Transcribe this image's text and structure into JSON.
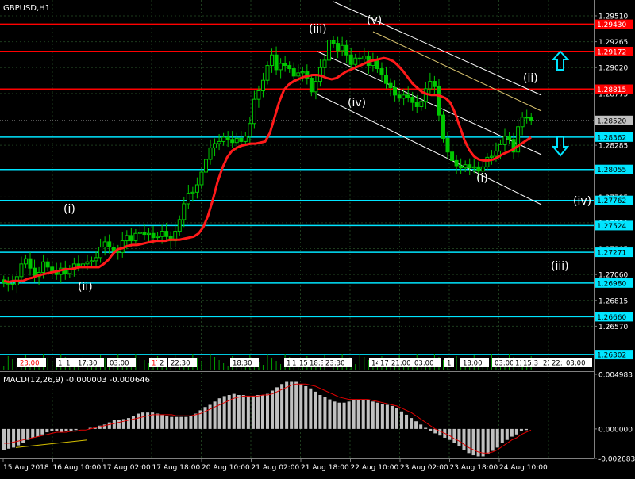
{
  "chart_data": [
    {
      "type": "candlestick",
      "title": "GBPUSD,H1",
      "ylim": [
        1.2616,
        1.296
      ],
      "price_axis_ticks": [
        "1.29510",
        "1.29265",
        "1.29020",
        "1.28775",
        "1.28285",
        "1.27795",
        "1.27550",
        "1.27305",
        "1.27060",
        "1.26815",
        "1.26570"
      ],
      "price_tags": [
        {
          "label": "1.29430",
          "kind": "resistance",
          "color": "#ff0000",
          "value": 1.2943
        },
        {
          "label": "1.29172",
          "kind": "resistance",
          "color": "#ff0000",
          "value": 1.29172
        },
        {
          "label": "1.28815",
          "kind": "resistance",
          "color": "#ff0000",
          "value": 1.28815
        },
        {
          "label": "1.28520",
          "kind": "current",
          "color": "#c0c0c0",
          "value": 1.2852
        },
        {
          "label": "1.28362",
          "kind": "support",
          "color": "#00e5ff",
          "value": 1.28362
        },
        {
          "label": "1.28055",
          "kind": "support",
          "color": "#00e5ff",
          "value": 1.28055
        },
        {
          "label": "1.27762",
          "kind": "support",
          "color": "#00e5ff",
          "value": 1.27762
        },
        {
          "label": "1.27524",
          "kind": "support",
          "color": "#00e5ff",
          "value": 1.27524
        },
        {
          "label": "1.27271",
          "kind": "support",
          "color": "#00e5ff",
          "value": 1.27271
        },
        {
          "label": "1.26980",
          "kind": "support",
          "color": "#00e5ff",
          "value": 1.2698
        },
        {
          "label": "1.26660",
          "kind": "support",
          "color": "#00e5ff",
          "value": 1.2666
        },
        {
          "label": "1.26302",
          "kind": "support",
          "color": "#00e5ff",
          "value": 1.26302
        }
      ],
      "wave_labels": [
        "(i)",
        "(ii)",
        "(iii)",
        "(iv)",
        "(v)",
        "(i)",
        "(ii)",
        "(iii)",
        "(iv)"
      ],
      "time_markers": [
        "23:00",
        "11:",
        "1",
        "17:30",
        "03:00",
        "17",
        "2",
        "22:30",
        "18:30",
        "1",
        "1",
        "15",
        "18:3",
        "23:30",
        "14",
        "17:",
        "21:00",
        "03:00",
        "1",
        "18:00",
        "03:00",
        "11:",
        "15:3",
        "20",
        "22:",
        "03:00"
      ],
      "close_series": [
        1.2698,
        1.2697,
        1.2696,
        1.2704,
        1.2716,
        1.2721,
        1.2712,
        1.2704,
        1.2708,
        1.2718,
        1.2713,
        1.2709,
        1.2706,
        1.2712,
        1.2707,
        1.2711,
        1.2716,
        1.2714,
        1.2716,
        1.2718,
        1.2719,
        1.2722,
        1.2732,
        1.2737,
        1.2732,
        1.2728,
        1.2727,
        1.2738,
        1.2743,
        1.2738,
        1.2745,
        1.2746,
        1.2744,
        1.2745,
        1.2741,
        1.2742,
        1.2747,
        1.2742,
        1.2738,
        1.2747,
        1.2758,
        1.2773,
        1.2783,
        1.2784,
        1.2791,
        1.2803,
        1.2815,
        1.2826,
        1.283,
        1.2832,
        1.2836,
        1.2834,
        1.2831,
        1.2835,
        1.2832,
        1.2837,
        1.2849,
        1.2872,
        1.288,
        1.289,
        1.2904,
        1.2914,
        1.29,
        1.2906,
        1.2904,
        1.2901,
        1.2894,
        1.2897,
        1.2898,
        1.2892,
        1.2879,
        1.2889,
        1.2902,
        1.2909,
        1.2928,
        1.2925,
        1.2918,
        1.2923,
        1.2914,
        1.2905,
        1.2911,
        1.291,
        1.2913,
        1.2904,
        1.2909,
        1.2901,
        1.2895,
        1.2887,
        1.2883,
        1.2876,
        1.2873,
        1.2876,
        1.2874,
        1.2869,
        1.2865,
        1.287,
        1.2882,
        1.2889,
        1.2884,
        1.2857,
        1.2835,
        1.2822,
        1.2814,
        1.2809,
        1.2807,
        1.281,
        1.2807,
        1.2808,
        1.2804,
        1.2808,
        1.2817,
        1.2818,
        1.2823,
        1.2829,
        1.2837,
        1.2834,
        1.2822,
        1.2846,
        1.2855,
        1.2855,
        1.2852
      ],
      "ma_series": [
        1.27,
        1.2699,
        1.27,
        1.27,
        1.27,
        1.2702,
        1.2703,
        1.2705,
        1.2706,
        1.2707,
        1.2708,
        1.2709,
        1.271,
        1.2711,
        1.2711,
        1.2712,
        1.2713,
        1.2713,
        1.2713,
        1.2713,
        1.2713,
        1.2716,
        1.272,
        1.2726,
        1.273,
        1.2731,
        1.2733,
        1.2734,
        1.2734,
        1.2735,
        1.2736,
        1.2737,
        1.2738,
        1.2738,
        1.2738,
        1.2739,
        1.2739,
        1.2739,
        1.274,
        1.2741,
        1.2742,
        1.2745,
        1.2751,
        1.2762,
        1.2777,
        1.2794,
        1.2807,
        1.2817,
        1.2823,
        1.2826,
        1.2828,
        1.2829,
        1.283,
        1.283,
        1.2831,
        1.2832,
        1.284,
        1.2855,
        1.287,
        1.2881,
        1.2886,
        1.2889,
        1.2891,
        1.2893,
        1.2894,
        1.2895,
        1.2895,
        1.2894,
        1.2892,
        1.2891,
        1.2892,
        1.2895,
        1.2898,
        1.29,
        1.2902,
        1.2904,
        1.2906,
        1.2908,
        1.2909,
        1.291,
        1.2911,
        1.291,
        1.2908,
        1.2904,
        1.2899,
        1.2893,
        1.2887,
        1.2883,
        1.2879,
        1.2877,
        1.2876,
        1.2876,
        1.2875,
        1.2873,
        1.2869,
        1.2859,
        1.2846,
        1.2833,
        1.2824,
        1.2818,
        1.2815,
        1.2814,
        1.2814,
        1.2815,
        1.2817,
        1.282,
        1.2822,
        1.2824,
        1.2827,
        1.283,
        1.2833,
        1.2836
      ],
      "annotations": [
        "up-arrow at 1.29172 (cyan outline)",
        "down-arrow near 1.28362 (cyan outline)",
        "descending channel (white lines)"
      ]
    },
    {
      "type": "bar",
      "title": "MACD(12,26,9) -0.000003 -0.000646",
      "ylim": [
        -0.002683,
        0.004983
      ],
      "axis_ticks": [
        "0.004983",
        "0.000000",
        "-0.002683"
      ],
      "histogram": [
        -0.0019,
        -0.0018,
        -0.0017,
        -0.0015,
        -0.0013,
        -0.001,
        -0.0008,
        -0.0007,
        -0.0005,
        -0.0003,
        -0.0002,
        -0.0002,
        -0.0003,
        -0.0002,
        -0.0002,
        -0.0001,
        0.0,
        0.0,
        0.0001,
        0.0002,
        0.0003,
        0.0004,
        0.0006,
        0.0008,
        0.0008,
        0.0009,
        0.001,
        0.0012,
        0.0014,
        0.0015,
        0.0015,
        0.0015,
        0.0014,
        0.0013,
        0.0012,
        0.0011,
        0.0011,
        0.0011,
        0.0011,
        0.0012,
        0.0014,
        0.0017,
        0.002,
        0.0022,
        0.0025,
        0.0028,
        0.003,
        0.0031,
        0.0032,
        0.0031,
        0.0031,
        0.003,
        0.003,
        0.0031,
        0.0031,
        0.0032,
        0.0035,
        0.0038,
        0.0041,
        0.0043,
        0.0043,
        0.0043,
        0.0041,
        0.0039,
        0.0037,
        0.0034,
        0.0031,
        0.0029,
        0.0027,
        0.0025,
        0.0024,
        0.0024,
        0.0025,
        0.0026,
        0.0027,
        0.0027,
        0.0026,
        0.0025,
        0.0024,
        0.0023,
        0.0022,
        0.0021,
        0.0019,
        0.0016,
        0.0013,
        0.001,
        0.0007,
        0.0004,
        0.0001,
        -0.0002,
        -0.0004,
        -0.0006,
        -0.0008,
        -0.001,
        -0.0013,
        -0.0016,
        -0.0019,
        -0.0022,
        -0.0024,
        -0.0025,
        -0.0025,
        -0.0023,
        -0.002,
        -0.0017,
        -0.0013,
        -0.001,
        -0.0007,
        -0.0005,
        -0.0002,
        -0.0001,
        0.0
      ],
      "signal": [
        -0.0013,
        -0.0013,
        -0.0012,
        -0.0011,
        -0.001,
        -0.0009,
        -0.0008,
        -0.0007,
        -0.0006,
        -0.0005,
        -0.0004,
        -0.0003,
        -0.0003,
        -0.0003,
        -0.0002,
        -0.0002,
        -0.0001,
        -0.0001,
        0.0,
        0.0001,
        0.0002,
        0.0003,
        0.0004,
        0.0005,
        0.0006,
        0.0007,
        0.0008,
        0.0009,
        0.001,
        0.0011,
        0.0012,
        0.0013,
        0.0013,
        0.0013,
        0.0013,
        0.0013,
        0.0012,
        0.0012,
        0.0012,
        0.0012,
        0.0013,
        0.0014,
        0.0016,
        0.0018,
        0.002,
        0.0022,
        0.0024,
        0.0026,
        0.0028,
        0.0029,
        0.003,
        0.003,
        0.003,
        0.003,
        0.0031,
        0.0031,
        0.0032,
        0.0034,
        0.0036,
        0.0038,
        0.004,
        0.0041,
        0.0041,
        0.0041,
        0.004,
        0.0039,
        0.0037,
        0.0035,
        0.0033,
        0.0031,
        0.0029,
        0.0028,
        0.0027,
        0.0027,
        0.0027,
        0.0027,
        0.0027,
        0.0026,
        0.0025,
        0.0024,
        0.0023,
        0.0022,
        0.0021,
        0.0019,
        0.0017,
        0.0015,
        0.0012,
        0.0009,
        0.0006,
        0.0003,
        0.0,
        -0.0002,
        -0.0004,
        -0.0006,
        -0.0009,
        -0.0011,
        -0.0014,
        -0.0017,
        -0.0019,
        -0.0021,
        -0.0022,
        -0.0022,
        -0.0021,
        -0.0019,
        -0.0016,
        -0.0013,
        -0.001,
        -0.0008,
        -0.0005,
        -0.0003,
        -0.0001
      ],
      "trend_line_color": "#d6c000"
    }
  ],
  "x_axis_labels": [
    "15 Aug 2018",
    "16 Aug 10:00",
    "17 Aug 02:00",
    "17 Aug 18:00",
    "20 Aug 10:00",
    "21 Aug 02:00",
    "21 Aug 18:00",
    "22 Aug 10:00",
    "23 Aug 02:00",
    "23 Aug 18:00",
    "24 Aug 10:00"
  ],
  "colors": {
    "background": "#000000",
    "grid": "#1d3b1d",
    "candle": "#00c800",
    "ma": "#ff1a1a",
    "resistance": "#ff0000",
    "support": "#00e5ff",
    "macd_hist": "#c0c0c0",
    "macd_signal": "#e00000",
    "axis_text": "#ffffff"
  }
}
